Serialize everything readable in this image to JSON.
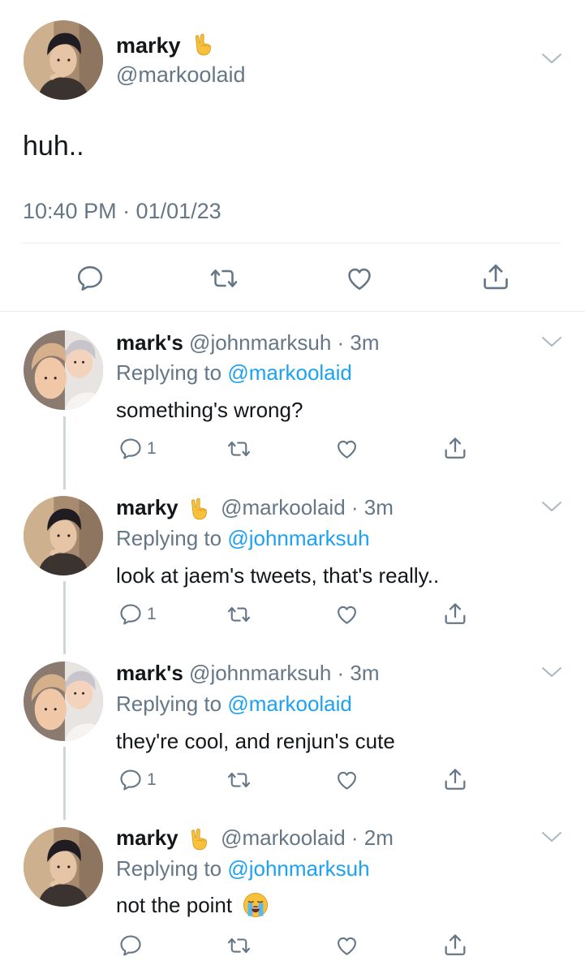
{
  "main_tweet": {
    "display_name": "marky",
    "name_emoji": "rock-on-hand-emoji",
    "handle": "@markoolaid",
    "text": "huh..",
    "timestamp": "10:40 PM · 01/01/23",
    "actions": [
      "reply-icon",
      "retweet-icon",
      "like-icon",
      "share-icon"
    ]
  },
  "replies": [
    {
      "display_name": "mark's",
      "handle": "@johnmarksuh",
      "time": "· 3m",
      "replying_label": "Replying to",
      "replying_to": "@markoolaid",
      "text": "something's wrong?",
      "reply_count": "1"
    },
    {
      "display_name": "marky",
      "handle": "@markoolaid",
      "time": "· 3m",
      "replying_label": "Replying to",
      "replying_to": "@johnmarksuh",
      "text": "look at jaem's tweets, that's really..",
      "reply_count": "1"
    },
    {
      "display_name": "mark's",
      "handle": "@johnmarksuh",
      "time": "· 3m",
      "replying_label": "Replying to",
      "replying_to": "@markoolaid",
      "text": "they're cool, and renjun's cute",
      "reply_count": "1"
    },
    {
      "display_name": "marky",
      "handle": "@markoolaid",
      "time": "· 2m",
      "replying_label": "Replying to",
      "replying_to": "@johnmarksuh",
      "text": "not the point",
      "text_emoji": "loudly-crying-face-emoji",
      "reply_count": ""
    }
  ],
  "colors": {
    "link": "#1da1f2",
    "muted": "#657786",
    "text": "#14171a",
    "divider": "#e6ecf0",
    "thread_line": "#ccd6dd"
  }
}
